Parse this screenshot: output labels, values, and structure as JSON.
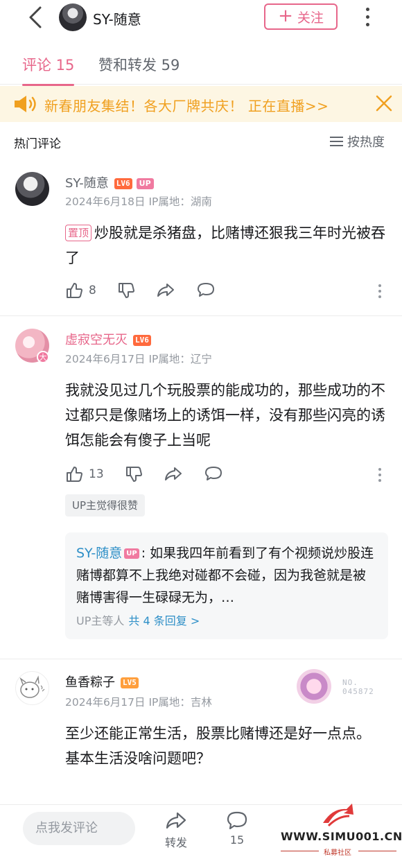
{
  "header": {
    "username": "SY-随意",
    "follow_label": "关注",
    "follow_plus": "+"
  },
  "tabs": [
    {
      "label": "评论 15",
      "active": true
    },
    {
      "label": "赞和转发 59",
      "active": false
    }
  ],
  "banner": {
    "text": "新春朋友集结！各大厂牌共庆！ 正在直播>>"
  },
  "section": {
    "title": "热门评论",
    "sort_label": "按热度"
  },
  "comments": [
    {
      "name": "SY-随意",
      "level": "LV6",
      "up_tag": "UP",
      "date_location": "2024年6月18日 IP属地：湖南",
      "pin_label": "置顶",
      "text": "炒股就是杀猪盘，比赌博还狠我三年时光被吞了",
      "likes": "8"
    },
    {
      "name": "虚寂空无灭",
      "level": "LV6",
      "avatar_badge": "大",
      "date_location": "2024年6月17日 IP属地：辽宁",
      "text": "我就没见过几个玩股票的能成功的，那些成功的不过都只是像赌场上的诱饵一样，没有那些闪亮的诱饵怎能会有傻子上当呢",
      "likes": "13",
      "liked_by_up": "UP主觉得很赞",
      "reply": {
        "name": "SY-随意",
        "up_tag": "UP",
        "text": ": 如果我四年前看到了有个视频说炒股连赌博都算不上我绝对碰都不会碰，因为我爸就是被赌博害得一生碌碌无为，…",
        "more_prefix": "UP主等人",
        "more_link": "共 4 条回复 >"
      }
    },
    {
      "name": "鱼香粽子",
      "level": "LV5",
      "date_location": "2024年6月17日 IP属地：吉林",
      "deco_number": "NO.\n045872",
      "text_line1": "至少还能正常生活，股票比赌博还是好一点点。",
      "text_line2": "基本生活没啥问题吧？"
    }
  ],
  "bottom_bar": {
    "input_placeholder": "点我发评论",
    "share_label": "转发",
    "comment_count": "15"
  },
  "watermark": {
    "url": "WWW.SIMU001.CN",
    "subtitle": "私募社区"
  },
  "colors": {
    "accent": "#e7668a",
    "banner_text": "#f0a020",
    "banner_bg": "#fdf6e3",
    "link": "#2e8fc7"
  }
}
